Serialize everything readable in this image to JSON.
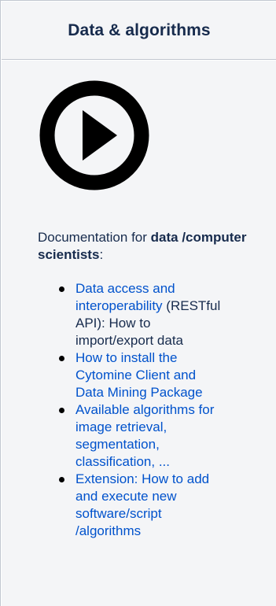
{
  "panel": {
    "title": "Data & algorithms",
    "play_icon": "play-circle-icon",
    "intro": {
      "prefix": "Documentation for ",
      "bold": "data /computer scientists",
      "suffix": ":"
    },
    "items": [
      {
        "link": "Data access and interoperability",
        "text": " (RESTful API): How to import/export data"
      },
      {
        "link": "How to install the Cytomine Client and Data Mining Package",
        "text": ""
      },
      {
        "link": "Available algorithms for image retrieval, segmentation, classification, ...",
        "text": ""
      },
      {
        "link": "Extension: How to add and execute new software/script /algorithms",
        "text": ""
      }
    ]
  },
  "colors": {
    "link": "#0052cc",
    "text": "#172b4d",
    "panel_bg": "#f4f5f7",
    "border": "#c1c7d0"
  }
}
